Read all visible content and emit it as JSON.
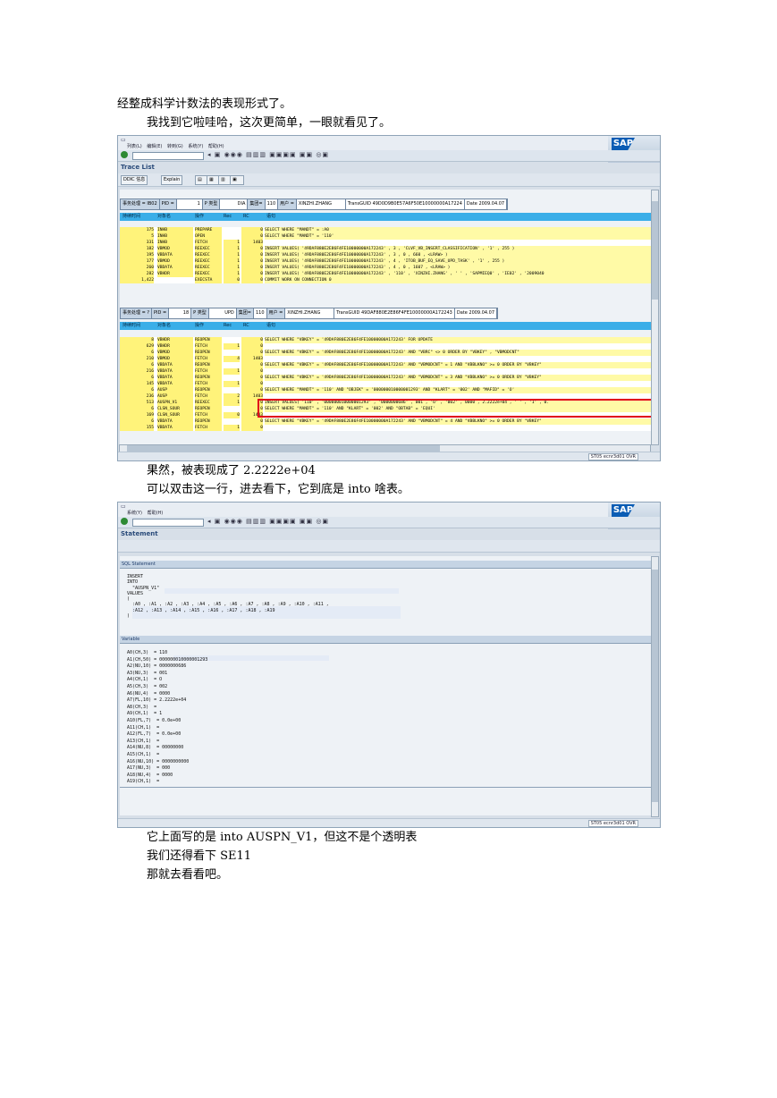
{
  "text": {
    "p1": "经整成科学计数法的表现形式了。",
    "p2": "我找到它啦哇哈，这次更简单，一眼就看见了。",
    "p3": "果然，被表现成了 2.2222e+04",
    "p4": "可以双击这一行，进去看下，它到底是 into 啥表。",
    "p5": "它上面写的是 into AUSPN_V1，但这不是个透明表",
    "p6": "我们还得看下 SE11",
    "p7": "那就去看看吧。"
  },
  "screen1": {
    "menus": [
      "列表(L)",
      "编辑(E)",
      "转到(G)",
      "系统(Y)",
      "帮助(H)"
    ],
    "title": "Trace List",
    "app_buttons": [
      "DDIC 信息",
      "Explain"
    ],
    "block1": {
      "hdr": [
        "事务处理 = IB02",
        "PID =",
        "1",
        "P 类型",
        "DIA",
        "集团=",
        "110",
        "用户 =",
        "XINZHI.ZHANG",
        "TransGUID 49D0D9B0E57A6F50E10000000A17224",
        "Date 2009.04.07"
      ],
      "cols": [
        "持续时间",
        "对象名",
        "操作",
        "Rec",
        "RC",
        "语句"
      ],
      "rows": [
        [
          "175",
          "INHB",
          "PREPARE",
          "",
          "0",
          "SELECT WHERE \"MANDT\" = :A0"
        ],
        [
          "5",
          "INHB",
          "OPEN",
          "",
          "0",
          "SELECT WHERE \"MANDT\" = '110'"
        ],
        [
          "331",
          "INHB",
          "FETCH",
          "1",
          "1403",
          ""
        ],
        [
          "182",
          "VBMOD",
          "REEXEC",
          "1",
          "0",
          "INSERT VALUES( '49DAF880E2E86F4FE10000000A172243' , 3 , 'CLVF_VB_INSERT_CLASSIFICATION' , '1' , 255 )"
        ],
        [
          "195",
          "VBDATA",
          "REEXEC",
          "1",
          "0",
          "INSERT VALUES( '49DAF880E2E86F4FE10000000A172243' , 3 , 0 , 660 , <LRAW> )"
        ],
        [
          "177",
          "VBMOD",
          "REEXEC",
          "1",
          "0",
          "INSERT VALUES( '49DAF880E2E86F4FE10000000A172243' , 4 , 'ITOB_BUF_EQ_SAVE_UPD_TASK' , '1' , 255 )"
        ],
        [
          "260",
          "VBDATA",
          "REEXEC",
          "1",
          "0",
          "INSERT VALUES( '49DAF880E2E86F4FE10000000A172243' , 4 , 0 , 1607 , <LRAW> )"
        ],
        [
          "282",
          "VBHDR",
          "REEXEC",
          "1",
          "0",
          "INSERT VALUES( '49DAF880E2E86F4FE10000000A172243' , '110' , 'XINZHI.ZHANG' , ' ' , 'SAPMIEQ0' , 'IE02' , '2009040"
        ],
        [
          "1,422",
          "",
          "EXECSTA",
          "0",
          "0",
          "COMMIT WORK ON CONNECTION 0"
        ]
      ]
    },
    "block2": {
      "hdr": [
        "事务处理 = ?",
        "PID =",
        "18",
        "P 类型",
        "UPD",
        "集团=",
        "110",
        "用户 =",
        "XINZHI.ZHANG",
        "TransGUID 49DAF880E2E86F4FE10000000A172243",
        "Date 2009.04.07"
      ],
      "cols": [
        "持续时间",
        "对象名",
        "操作",
        "Rec",
        "RC",
        "语句"
      ],
      "rows": [
        [
          "8",
          "VBHDR",
          "REOPEN",
          "",
          "0",
          "SELECT WHERE \"VBKEY\" = '49DAF880E2E86F4FE10000000A172243' FOR UPDATE"
        ],
        [
          "629",
          "VBHDR",
          "FETCH",
          "1",
          "0",
          ""
        ],
        [
          "6",
          "VBMOD",
          "REOPEN",
          "",
          "0",
          "SELECT WHERE \"VBKEY\" = '49DAF880E2E86F4FE10000000A172243' AND \"VBRC\" <> 0 ORDER BY \"VBKEY\" , \"VBMODCNT\""
        ],
        [
          "210",
          "VBMOD",
          "FETCH",
          "4",
          "1403",
          ""
        ],
        [
          "6",
          "VBDATA",
          "REOPEN",
          "",
          "0",
          "SELECT WHERE \"VBKEY\" = '49DAF880E2E86F4FE10000000A172243' AND \"VBMODCNT\" = 1 AND \"VBBLKNO\" >= 0 ORDER BY \"VBKEY\""
        ],
        [
          "216",
          "VBDATA",
          "FETCH",
          "1",
          "0",
          ""
        ],
        [
          "6",
          "VBDATA",
          "REOPEN",
          "",
          "0",
          "SELECT WHERE \"VBKEY\" = '49DAF880E2E86F4FE10000000A172243' AND \"VBMODCNT\" = 3 AND \"VBBLKNO\" >= 0 ORDER BY \"VBKEY\""
        ],
        [
          "145",
          "VBDATA",
          "FETCH",
          "1",
          "0",
          ""
        ],
        [
          "6",
          "AUSP",
          "REOPEN",
          "",
          "0",
          "SELECT WHERE \"MANDT\" = '110' AND \"OBJEK\" = '000000010000001293' AND \"KLART\" = '002' AND \"MAFID\" = 'O'"
        ],
        [
          "236",
          "AUSP",
          "FETCH",
          "2",
          "1403",
          ""
        ],
        [
          "513",
          "AUSPN_V1",
          "REEXEC",
          "1",
          "0",
          "INSERT VALUES( '110' , '000000010000001293' , '0000000686' , 001 , 'O' , '002' , 0000 , 2.2222e+04 , ' ' , '1' , 0."
        ],
        [
          "6",
          "CLSN_SOUR",
          "REOPEN",
          "",
          "0",
          "SELECT WHERE \"MANDT\" = '110' AND \"KLART\" = '002' AND \"OBTAB\" = 'EQUI'"
        ],
        [
          "169",
          "CLSN_SOUR",
          "FETCH",
          "0",
          "1403",
          ""
        ],
        [
          "6",
          "VBDATA",
          "REOPEN",
          "",
          "0",
          "SELECT WHERE \"VBKEY\" = '49DAF880E2E86F4FE10000000A172243' AND \"VBMODCNT\" = 4 AND \"VBBLKNO\" >= 0 ORDER BY \"VBKEY\""
        ],
        [
          "155",
          "VBDATA",
          "FETCH",
          "1",
          "0",
          ""
        ]
      ]
    },
    "status_sys": "ST05",
    "status_host": "ecnr3d01",
    "status_mode": "OVR"
  },
  "screen2": {
    "menus": [
      "系统(Y)",
      "帮助(H)"
    ],
    "title": "Statement",
    "sect_sql": "SQL Statement",
    "sql": "INSERT\nINTO\n  \"AUSPN_V1\"\nVALUES\n(\n  :A0 , :A1 , :A2 , :A3 , :A4 , :A5 , :A6 , :A7 , :A8 , :A9 , :A10 , :A11 ,\n  :A12 , :A13 , :A14 , :A15 , :A16 , :A17 , :A18 , :A19\n)",
    "sect_var": "Variable",
    "vars": "A0(CH,3)  = 110\nA1(CH,50) = 000000010000001293\nA2(NU,10) = 0000000686\nA3(NU,3)  = 001\nA4(CH,1)  = O\nA5(CH,3)  = 002\nA6(NU,4)  = 0000\nA7(FL,10) = 2.2222e+04\nA8(CH,3)  =\nA9(CH,1)  = 1\nA10(FL,7)  = 0.0e+00\nA11(CH,1)  =\nA12(FL,7)  = 0.0e+00\nA13(CH,1)  =\nA14(NU,8)  = 00000000\nA15(CH,1)  =\nA16(NU,10) = 0000000000\nA17(NU,3)  = 000\nA18(NU,4)  = 0000\nA19(CH,1)  =",
    "status_sys": "ST05",
    "status_host": "ecnr3d01",
    "status_mode": "OVR"
  }
}
